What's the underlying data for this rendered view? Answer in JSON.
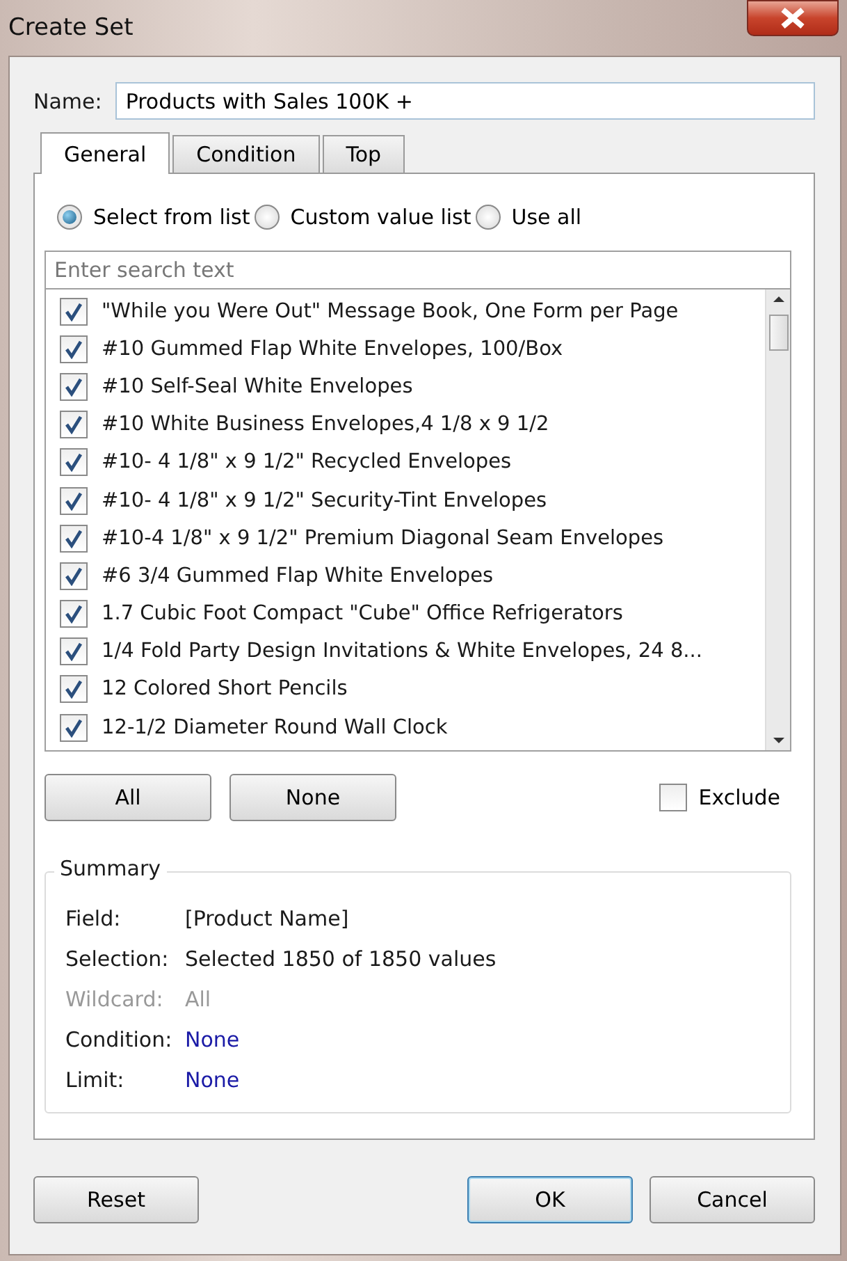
{
  "window": {
    "title": "Create Set"
  },
  "name_field": {
    "label": "Name:",
    "value": "Products with Sales 100K +"
  },
  "tabs": [
    {
      "label": "General",
      "selected": true
    },
    {
      "label": "Condition",
      "selected": false
    },
    {
      "label": "Top",
      "selected": false
    }
  ],
  "mode_options": [
    {
      "label": "Select from list",
      "selected": true
    },
    {
      "label": "Custom value list",
      "selected": false
    },
    {
      "label": "Use all",
      "selected": false
    }
  ],
  "search": {
    "placeholder": "Enter search text"
  },
  "items": [
    {
      "label": "\"While you Were Out\" Message Book, One Form per Page",
      "checked": true
    },
    {
      "label": "#10 Gummed Flap White Envelopes, 100/Box",
      "checked": true
    },
    {
      "label": "#10 Self-Seal White Envelopes",
      "checked": true
    },
    {
      "label": "#10 White Business Envelopes,4 1/8 x 9 1/2",
      "checked": true
    },
    {
      "label": "#10- 4 1/8\" x 9 1/2\" Recycled Envelopes",
      "checked": true
    },
    {
      "label": "#10- 4 1/8\" x 9 1/2\" Security-Tint Envelopes",
      "checked": true
    },
    {
      "label": "#10-4 1/8\" x 9 1/2\" Premium Diagonal Seam Envelopes",
      "checked": true
    },
    {
      "label": "#6 3/4 Gummed Flap White Envelopes",
      "checked": true
    },
    {
      "label": "1.7 Cubic Foot Compact \"Cube\" Office Refrigerators",
      "checked": true
    },
    {
      "label": "1/4 Fold Party Design Invitations & White Envelopes, 24 8...",
      "checked": true
    },
    {
      "label": "12 Colored Short Pencils",
      "checked": true
    },
    {
      "label": "12-1/2 Diameter Round Wall Clock",
      "checked": true
    }
  ],
  "list_buttons": [
    "All",
    "None"
  ],
  "exclude": {
    "label": "Exclude",
    "checked": false
  },
  "summary": {
    "title": "Summary",
    "rows": [
      {
        "label": "Field:",
        "value": "[Product Name]",
        "kind": "text",
        "disabled": false
      },
      {
        "label": "Selection:",
        "value": "Selected 1850 of 1850 values",
        "kind": "text",
        "disabled": false
      },
      {
        "label": "Wildcard:",
        "value": "All",
        "kind": "text",
        "disabled": true
      },
      {
        "label": "Condition:",
        "value": "None",
        "kind": "link",
        "disabled": false
      },
      {
        "label": "Limit:",
        "value": "None",
        "kind": "link",
        "disabled": false
      }
    ]
  },
  "buttons": [
    {
      "label": "Reset",
      "kind": "plain"
    },
    {
      "label": "OK",
      "kind": "default"
    },
    {
      "label": "Cancel",
      "kind": "plain"
    }
  ]
}
